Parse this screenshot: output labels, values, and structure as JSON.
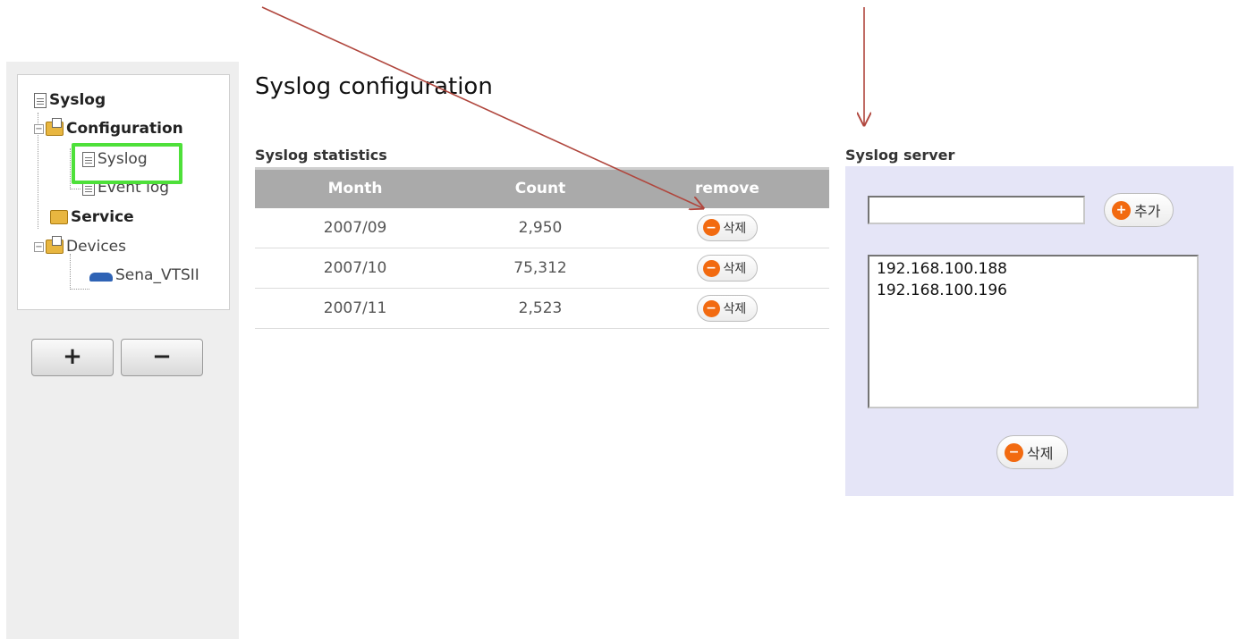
{
  "tree": {
    "root": "Syslog",
    "configuration": "Configuration",
    "syslog": "Syslog",
    "event_log": "Event log",
    "service": "Service",
    "devices": "Devices",
    "device_name": "Sena_VTSII",
    "add_label": "+",
    "remove_label": "−"
  },
  "page_title": "Syslog configuration",
  "stats": {
    "title": "Syslog statistics",
    "headers": [
      "Month",
      "Count",
      "remove"
    ],
    "rows": [
      {
        "month": "2007/09",
        "count": "2,950",
        "action": "삭제"
      },
      {
        "month": "2007/10",
        "count": "75,312",
        "action": "삭제"
      },
      {
        "month": "2007/11",
        "count": "2,523",
        "action": "삭제"
      }
    ]
  },
  "server": {
    "title": "Syslog server",
    "input_value": "",
    "add_label": "추가",
    "list": [
      "192.168.100.188",
      "192.168.100.196"
    ],
    "delete_label": "삭제"
  },
  "colors": {
    "accent": "#f26a10",
    "highlight": "#4ee03a",
    "arrow": "#b0463d",
    "server_panel_bg": "#e5e5f7"
  }
}
